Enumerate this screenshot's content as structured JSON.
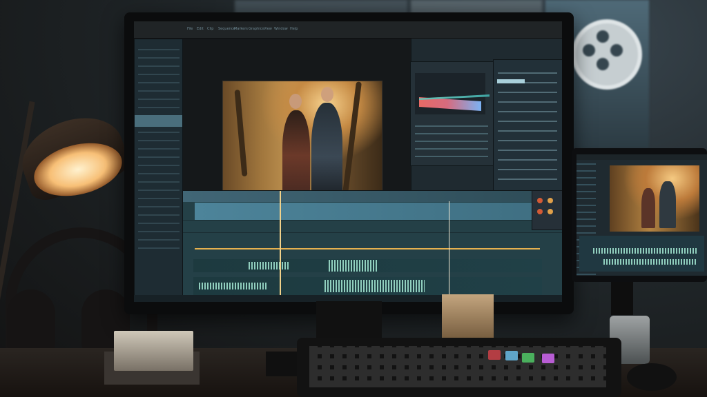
{
  "scene": {
    "main_monitor": {
      "menu": [
        "File",
        "Edit",
        "Clip",
        "Sequence",
        "Markers",
        "Graphics",
        "View",
        "Window",
        "Help"
      ],
      "timeline_title": "",
      "clip_label": "",
      "taskbar_label": ""
    },
    "colors": {
      "lamp_glow": "#f7bf76",
      "screen_bg": "#1f2a30",
      "timeline_blue": "#4d849a",
      "audio_wave": "#91cfbe",
      "playhead": "#f1d18a"
    },
    "icons": {
      "lamp": "desk-lamp-icon",
      "headphones": "headphones-icon",
      "film_reel": "film-reel-icon"
    }
  }
}
